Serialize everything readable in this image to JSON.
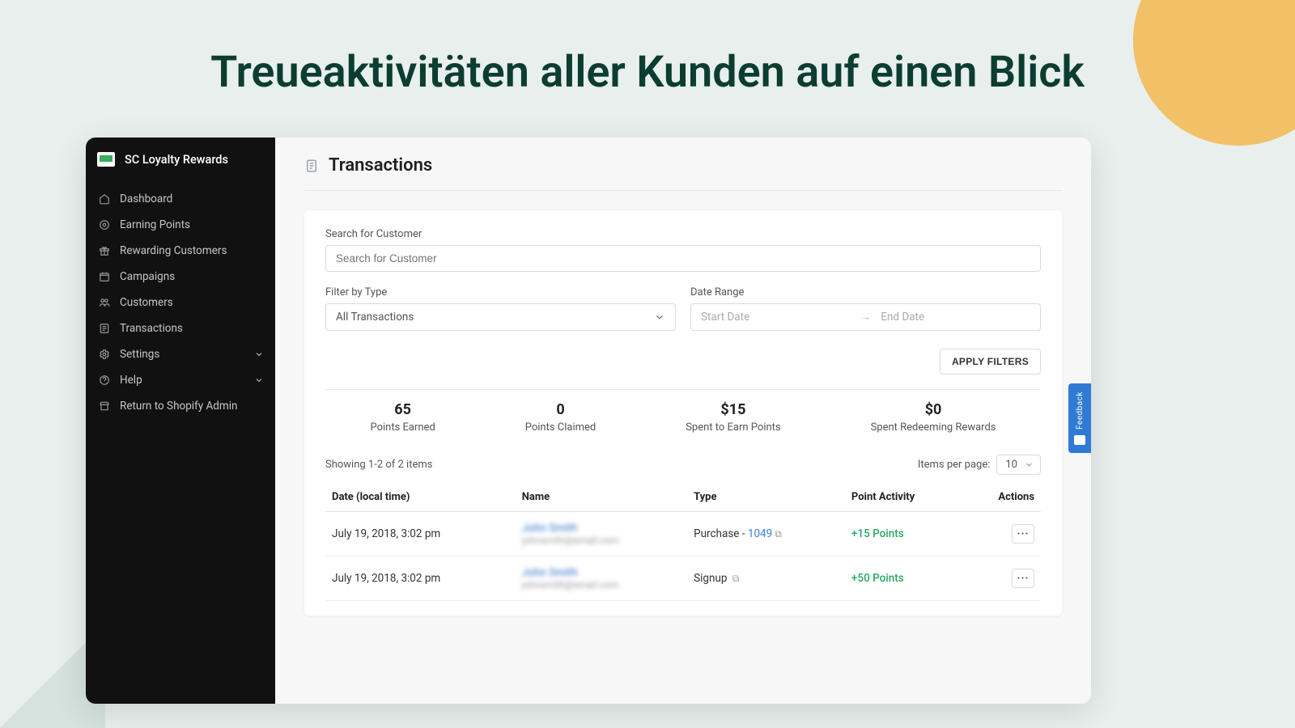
{
  "headline": "Treueaktivitäten aller Kunden auf einen Blick",
  "app_name": "SC Loyalty Rewards",
  "sidebar": {
    "items": [
      {
        "label": "Dashboard",
        "icon": "home-icon",
        "expandable": false
      },
      {
        "label": "Earning Points",
        "icon": "target-icon",
        "expandable": false
      },
      {
        "label": "Rewarding Customers",
        "icon": "gift-icon",
        "expandable": false
      },
      {
        "label": "Campaigns",
        "icon": "calendar-icon",
        "expandable": false
      },
      {
        "label": "Customers",
        "icon": "users-icon",
        "expandable": false
      },
      {
        "label": "Transactions",
        "icon": "list-icon",
        "expandable": false
      },
      {
        "label": "Settings",
        "icon": "gear-icon",
        "expandable": true
      },
      {
        "label": "Help",
        "icon": "help-icon",
        "expandable": true
      },
      {
        "label": "Return to Shopify Admin",
        "icon": "store-icon",
        "expandable": false
      }
    ]
  },
  "page": {
    "title": "Transactions",
    "search_label": "Search for Customer",
    "search_placeholder": "Search for Customer",
    "filter_type_label": "Filter by Type",
    "filter_type_value": "All Transactions",
    "date_range_label": "Date Range",
    "start_date_placeholder": "Start Date",
    "end_date_placeholder": "End Date",
    "apply_btn": "APPLY FILTERS",
    "stats": [
      {
        "value": "65",
        "label": "Points Earned"
      },
      {
        "value": "0",
        "label": "Points Claimed"
      },
      {
        "value": "$15",
        "label": "Spent to Earn Points"
      },
      {
        "value": "$0",
        "label": "Spent Redeeming Rewards"
      }
    ],
    "showing_text": "Showing 1-2 of 2 items",
    "items_per_page_label": "Items per page:",
    "items_per_page_value": "10",
    "columns": {
      "date": "Date (local time)",
      "name": "Name",
      "type": "Type",
      "activity": "Point Activity",
      "actions": "Actions"
    },
    "rows": [
      {
        "date": "July 19, 2018, 3:02 pm",
        "name": "John Smith",
        "email": "johnsmith@email.com",
        "type_prefix": "Purchase - ",
        "type_link": "1049",
        "points": "+15 Points"
      },
      {
        "date": "July 19, 2018, 3:02 pm",
        "name": "John Smith",
        "email": "johnsmith@email.com",
        "type_prefix": "Signup ",
        "type_link": "",
        "points": "+50 Points"
      }
    ]
  },
  "feedback_label": "Feedback"
}
